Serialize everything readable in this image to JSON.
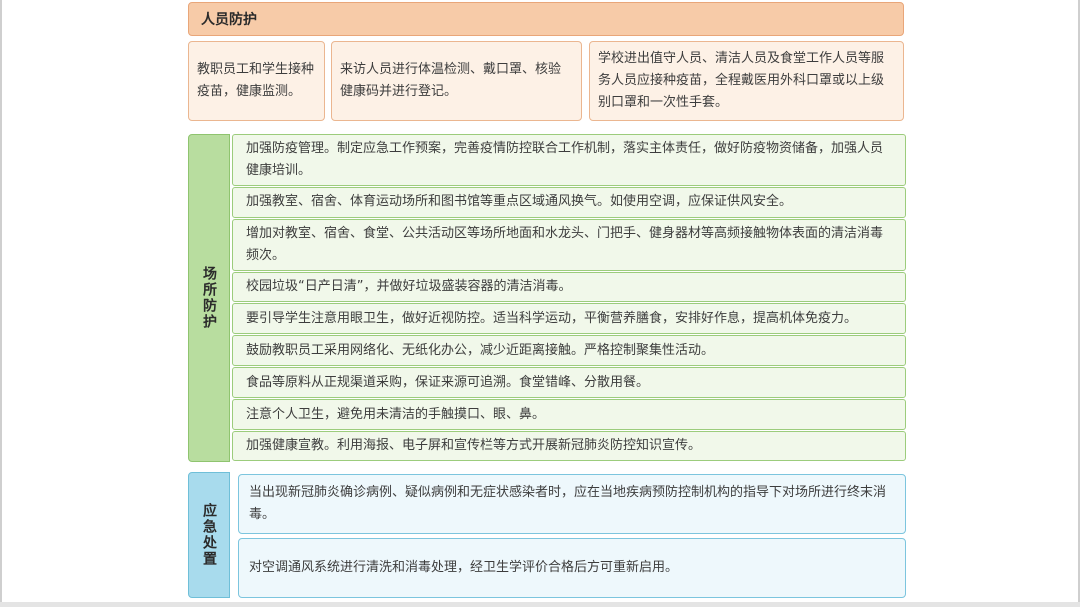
{
  "personnel": {
    "title": "人员防护",
    "boxes": [
      "教职员工和学生接种疫苗，健康监测。",
      "来访人员进行体温检测、戴口罩、核验健康码并进行登记。",
      "学校进出值守人员、清洁人员及食堂工作人员等服务人员应接种疫苗，全程戴医用外科口罩或以上级别口罩和一次性手套。"
    ]
  },
  "venue": {
    "label": "场所防护",
    "items": [
      "加强防疫管理。制定应急工作预案，完善疫情防控联合工作机制，落实主体责任，做好防疫物资储备，加强人员健康培训。",
      "加强教室、宿舍、体育运动场所和图书馆等重点区域通风换气。如使用空调，应保证供风安全。",
      "增加对教室、宿舍、食堂、公共活动区等场所地面和水龙头、门把手、健身器材等高频接触物体表面的清洁消毒频次。",
      "校园垃圾“日产日清”，并做好垃圾盛装容器的清洁消毒。",
      "要引导学生注意用眼卫生，做好近视防控。适当科学运动，平衡营养膳食，安排好作息，提高机体免疫力。",
      "鼓励教职员工采用网络化、无纸化办公，减少近距离接触。严格控制聚集性活动。",
      "食品等原料从正规渠道采购，保证来源可追溯。食堂错峰、分散用餐。",
      "注意个人卫生，避免用未清洁的手触摸口、眼、鼻。",
      "加强健康宣教。利用海报、电子屏和宣传栏等方式开展新冠肺炎防控知识宣传。"
    ]
  },
  "emergency": {
    "label": "应急处置",
    "items": [
      "当出现新冠肺炎确诊病例、疑似病例和无症状感染者时，应在当地疾病预防控制机构的指导下对场所进行终末消毒。",
      "对空调通风系统进行清洗和消毒处理，经卫生学评价合格后方可重新启用。"
    ]
  }
}
